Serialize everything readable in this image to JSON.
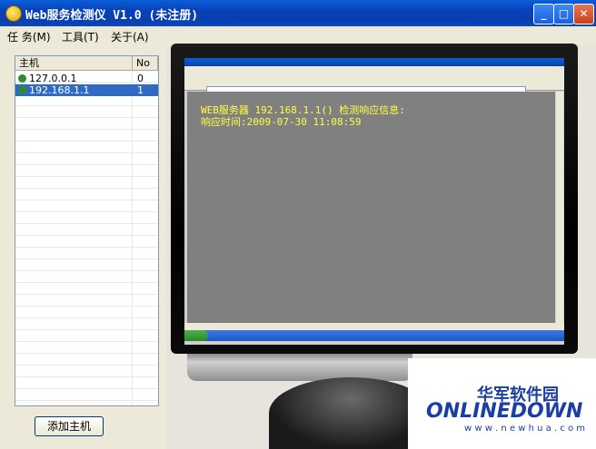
{
  "window": {
    "title": "Web服务检测仪 V1.0 (未注册)",
    "min": "_",
    "max": "□",
    "close": "✕"
  },
  "menu": [
    "任 务(M)",
    "工具(T)",
    "关于(A)"
  ],
  "list": {
    "headers": {
      "host": "主机",
      "no": "No"
    },
    "rows": [
      {
        "host": "127.0.0.1",
        "no": "0"
      },
      {
        "host": "192.168.1.1",
        "no": "1"
      }
    ]
  },
  "add_button": "添加主机",
  "screen": {
    "line1": "WEB服务器 192.168.1.1() 检测响应信息:",
    "line2": "响应时间:2009-07-30 11:08:59"
  },
  "watermark": {
    "cn": "华军软件园",
    "en": "ONLINEDOWN",
    "url": "w w w . n e w h u a . c o m"
  }
}
